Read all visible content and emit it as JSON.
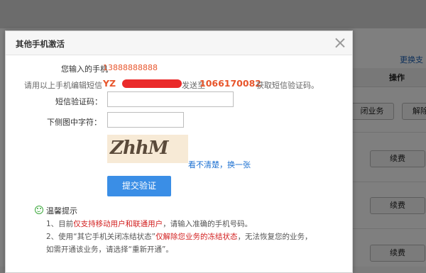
{
  "background": {
    "change_link": "更换支",
    "column_title": "操作",
    "close_service_button": "闭业务",
    "unbind_button": "解除",
    "renew_buttons": [
      "续费",
      "续费",
      "续费"
    ]
  },
  "dialog": {
    "title": "其他手机激活",
    "phone_label": "您输入的手机",
    "phone_value": "13888888888",
    "sms_prefix": "请用以上手机编辑短信",
    "sms_code_prefix": "YZ",
    "sms_send_to": "发送至",
    "sms_number": "1066170082",
    "sms_suffix": "获取短信验证码。",
    "sms_code_label": "短信验证码：",
    "captcha_label": "下侧图中字符：",
    "captcha_image_text": "ZhhM",
    "captcha_refresh": "看不清楚，换一张",
    "submit_label": "提交验证",
    "tips_title": "温馨提示",
    "tip1_pre": "1、目前",
    "tip1_hl": "仅支持移动用户和联通用户",
    "tip1_post": "，请输入准确的手机号码。",
    "tip2_pre": "2、使用“其它手机关闭冻结状态”",
    "tip2_hl": "仅解除您业务的冻结状态",
    "tip2_post": "，无法恢复您的业务，",
    "tip2_line2": "如需开通该业务，请选择“重新开通”。"
  },
  "colors": {
    "accent": "#3a8ee6",
    "highlight": "#e8552b",
    "link": "#1a6fd1"
  }
}
